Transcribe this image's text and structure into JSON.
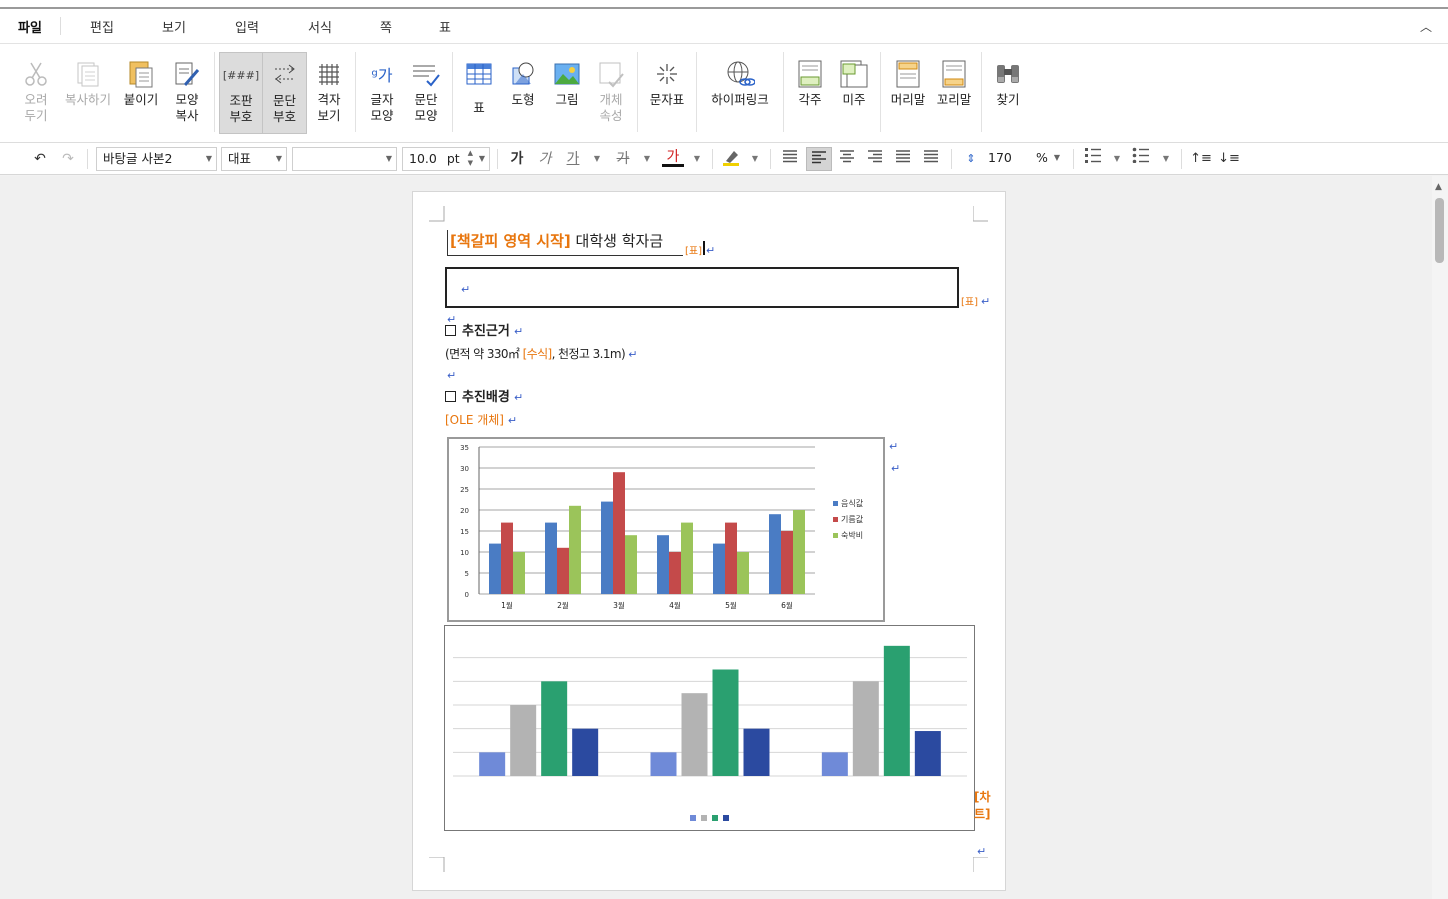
{
  "menu": {
    "items": [
      "파일",
      "편집",
      "보기",
      "입력",
      "서식",
      "쪽",
      "표"
    ],
    "collapse_icon": "chevron-up-icon"
  },
  "ribbon": {
    "cut": "오려\n두기",
    "copy": "복사하기",
    "paste": "붙이기",
    "format_copy": "모양\n복사",
    "layout_marks": "조판\n부호",
    "para_marks": "문단\n부호",
    "grid_view": "격자\n보기",
    "char_shape": "글자\n모양",
    "para_shape": "문단\n모양",
    "table": "표",
    "shape": "도형",
    "picture": "그림",
    "object_props": "개체\n속성",
    "char_table": "문자표",
    "hyperlink": "하이퍼링크",
    "footnote": "각주",
    "endnote": "미주",
    "header": "머리말",
    "footer": "꼬리말",
    "find": "찾기",
    "layout_icon_text": "[###]"
  },
  "format": {
    "style": "바탕글 사본2",
    "font_lang": "대표",
    "font_name": "",
    "size": "10.0",
    "size_unit": "pt",
    "line_spacing": "170",
    "line_unit": "%",
    "bold_glyph": "가",
    "italic_glyph": "가",
    "underline_glyph": "가",
    "strike_glyph": "가",
    "color_glyph": "가"
  },
  "doc": {
    "bookmark_start": "[책갈피 영역 시작]",
    "title_text": "대학생 학자금",
    "table_tag": "[표]",
    "table_tag2": "[표]",
    "sec1_title": "추진근거",
    "sec1_line_pre": "(면적 약 330㎡",
    "formula_tag": "[수식]",
    "sec1_line_post": ", 천정고 3.1m)",
    "sec2_title": "추진배경",
    "ole_tag": "[OLE 개체]",
    "chart_tag": "[차트]",
    "return_mark": "↵"
  },
  "chart_data": [
    {
      "type": "bar",
      "categories": [
        "1월",
        "2월",
        "3월",
        "4월",
        "5월",
        "6월"
      ],
      "series": [
        {
          "name": "음식값",
          "values": [
            12,
            17,
            22,
            14,
            12,
            19
          ],
          "color": "#4a7cc4"
        },
        {
          "name": "기름값",
          "values": [
            17,
            11,
            29,
            10,
            17,
            15
          ],
          "color": "#c44a4a"
        },
        {
          "name": "숙박비",
          "values": [
            10,
            21,
            14,
            17,
            10,
            20
          ],
          "color": "#9bc45a"
        }
      ],
      "ylim": [
        0,
        35
      ],
      "yticks": [
        0,
        5,
        10,
        15,
        20,
        25,
        30,
        35
      ],
      "grid": true,
      "legend": "right"
    },
    {
      "type": "bar",
      "categories": [
        "",
        "",
        ""
      ],
      "series": [
        {
          "values": [
            1,
            1,
            1
          ],
          "color": "#6f8ad8"
        },
        {
          "values": [
            3,
            3.5,
            4
          ],
          "color": "#b3b3b3"
        },
        {
          "values": [
            4,
            4.5,
            5.5
          ],
          "color": "#2aa070"
        },
        {
          "values": [
            2,
            2,
            1.9
          ],
          "color": "#2b4aa0"
        }
      ],
      "ylim": [
        0,
        6
      ],
      "grid": true,
      "legend": "bottom"
    }
  ]
}
